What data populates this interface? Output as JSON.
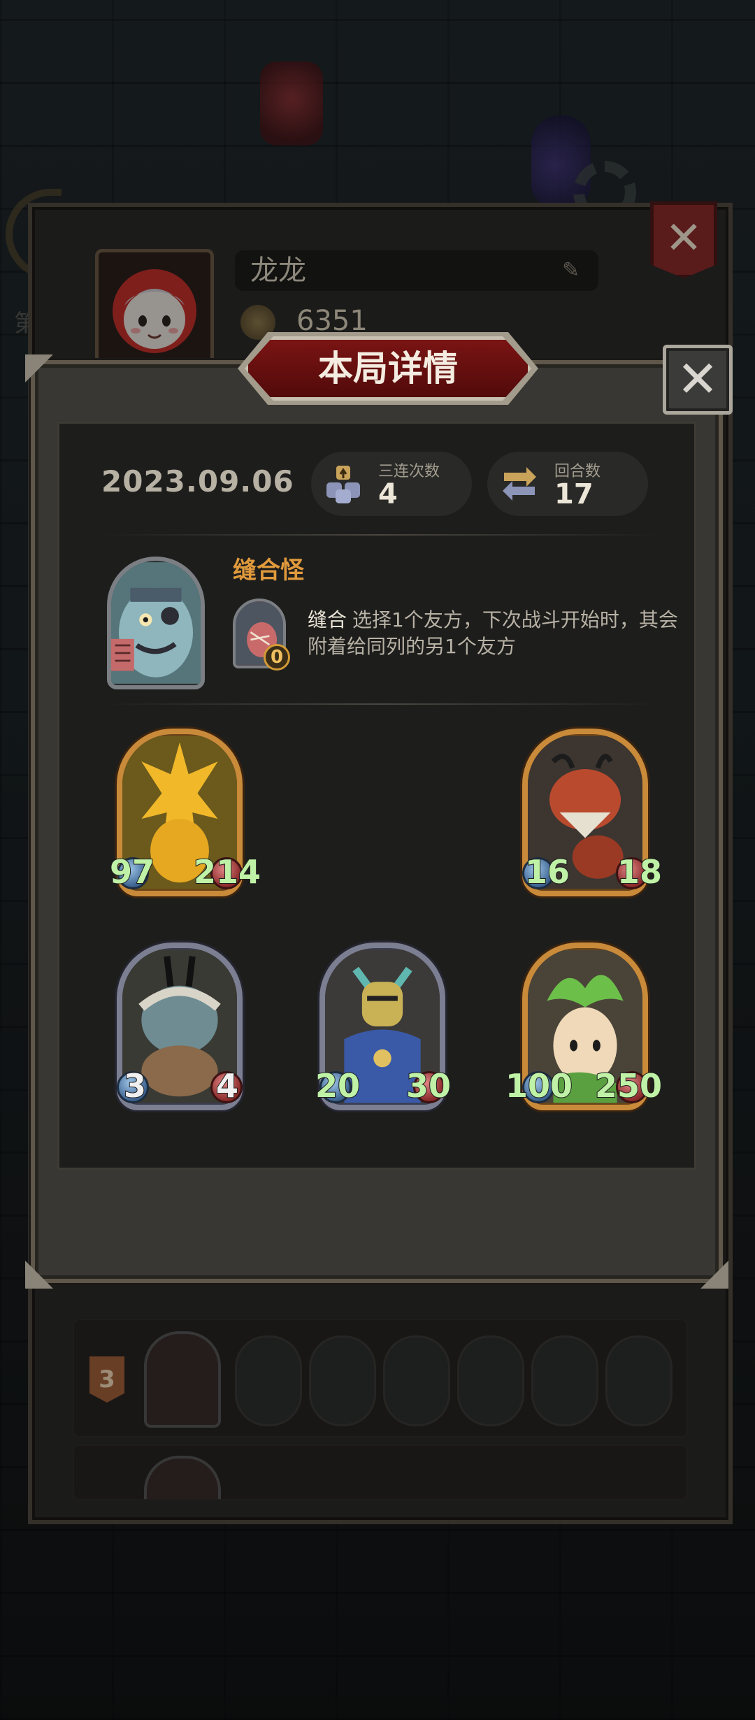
{
  "profile": {
    "name": "龙龙",
    "coins": "6351",
    "side_label": "第"
  },
  "modal": {
    "title": "本局详情",
    "close_glyph": "✕",
    "date": "2023.09.06",
    "stats": [
      {
        "label": "三连次数",
        "value": "4",
        "icon": "stacked-blocks-icon"
      },
      {
        "label": "回合数",
        "value": "17",
        "icon": "refresh-arrows-icon"
      }
    ],
    "hero": {
      "name": "缝合怪",
      "skill_count": "0",
      "skill_name": "缝合",
      "skill_desc": "选择1个友方，下次战斗开始时，其会附着给同列的另1个友方"
    },
    "cards": [
      {
        "name": "golden-dragon",
        "atk": "97",
        "hp": "214",
        "frame": "gold",
        "color": "#f1b82a"
      },
      {
        "name": "red-wyrm",
        "atk": "16",
        "hp": "18",
        "frame": "gold",
        "color": "#b94a2e"
      },
      {
        "name": "horned-demon",
        "atk": "3",
        "hp": "4",
        "frame": "silver",
        "color": "#6e8c92"
      },
      {
        "name": "armored-knight",
        "atk": "20",
        "hp": "30",
        "frame": "silver",
        "color": "#c9b256"
      },
      {
        "name": "leaf-sprout",
        "atk": "100",
        "hp": "250",
        "frame": "gold",
        "color": "#6cc04a"
      }
    ]
  },
  "ranking": {
    "row_rank": "3"
  },
  "colors": {
    "title_banner": "#7a1414",
    "hero_name": "#e09a3c",
    "stat_number": "#bff2a6"
  }
}
